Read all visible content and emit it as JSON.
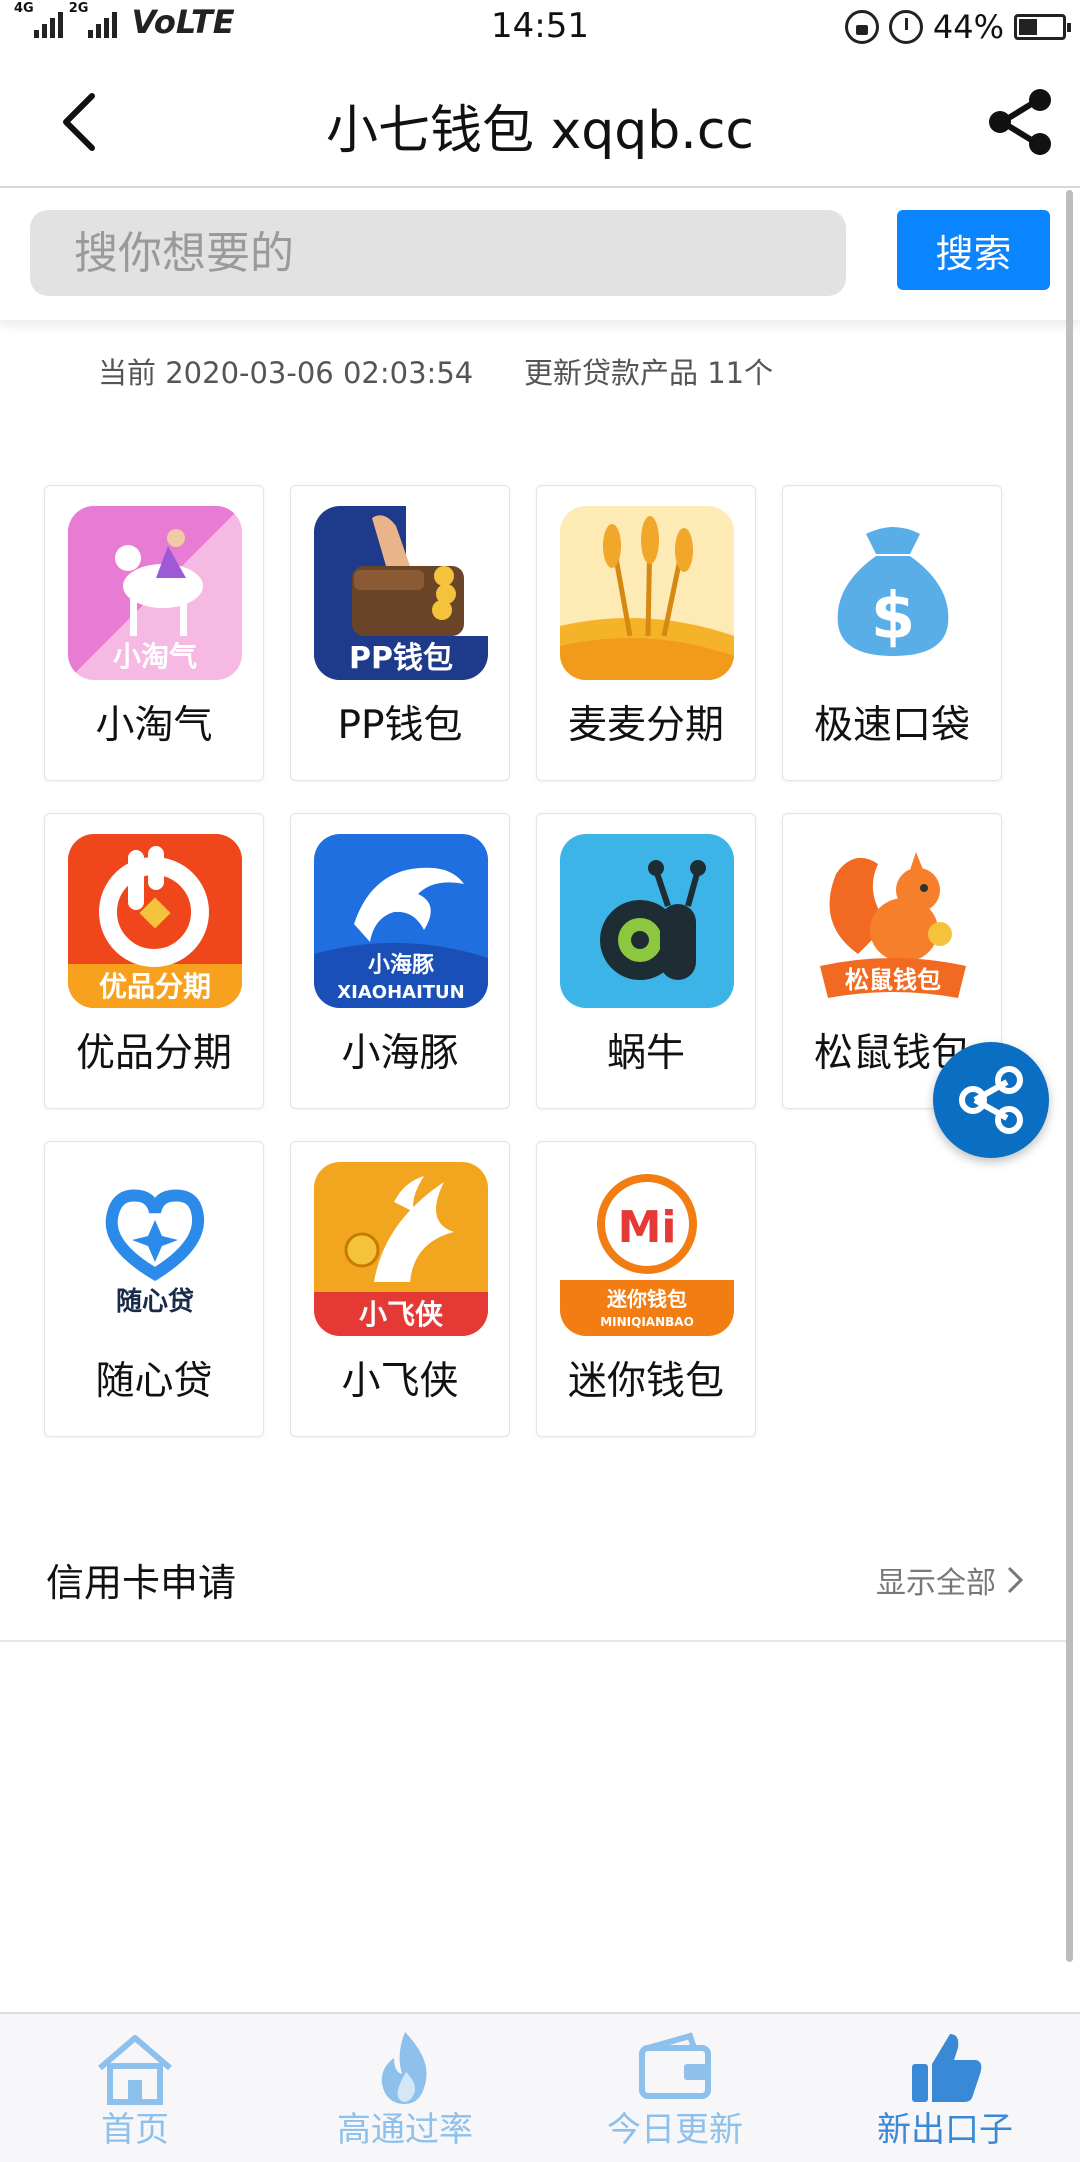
{
  "status_bar": {
    "network_left": "4G",
    "network_right": "2G",
    "carrier_label": "VoLTE",
    "time": "14:51",
    "battery_percent": "44%",
    "battery_level": 0.44,
    "icons": [
      "lock-rotation-icon",
      "alarm-icon",
      "battery-icon"
    ]
  },
  "header": {
    "title": "小七钱包 xqqb.cc",
    "back_icon": "chevron-left-icon",
    "share_icon": "share-icon"
  },
  "search": {
    "placeholder": "搜你想要的",
    "button_label": "搜索"
  },
  "info": {
    "current_label": "当前 2020-03-06 02:03:54",
    "update_label": "更新贷款产品 11个"
  },
  "products": [
    {
      "name": "小淘气",
      "logo_text": "小淘气",
      "color": "#f08ad0"
    },
    {
      "name": "PP钱包",
      "logo_text": "PP钱包",
      "color": "#1e3a8a"
    },
    {
      "name": "麦麦分期",
      "logo_text": "",
      "color": "#f5a623"
    },
    {
      "name": "极速口袋",
      "logo_text": "$",
      "color": "#5aaee8"
    },
    {
      "name": "优品分期",
      "logo_text": "优品分期",
      "color": "#f0461c"
    },
    {
      "name": "小海豚",
      "logo_text": "小海豚",
      "logo_subtext": "XIAOHAITUN",
      "color": "#1f6fe0"
    },
    {
      "name": "蜗牛",
      "logo_text": "",
      "color": "#3db4e8"
    },
    {
      "name": "松鼠钱包",
      "logo_text": "松鼠钱包",
      "color": "#f26a21"
    },
    {
      "name": "随心贷",
      "logo_text": "随心贷",
      "color": "#2c8ae8"
    },
    {
      "name": "小飞侠",
      "logo_text": "小飞侠",
      "color": "#f2a51e"
    },
    {
      "name": "迷你钱包",
      "logo_text": "迷你钱包",
      "logo_subtext": "MINIQIANBAO",
      "color": "#f27d12"
    }
  ],
  "credit_card": {
    "title": "信用卡申请",
    "show_all": "显示全部"
  },
  "bottom_nav": [
    {
      "label": "首页",
      "icon": "home-icon"
    },
    {
      "label": "高通过率",
      "icon": "flame-icon"
    },
    {
      "label": "今日更新",
      "icon": "wallet-icon"
    },
    {
      "label": "新出口子",
      "icon": "thumbs-up-icon",
      "active": true
    }
  ],
  "colors": {
    "accent": "#0a84ff",
    "fab": "#0a6fc2",
    "nav_inactive": "#8ec0ec",
    "nav_active": "#3a89d6"
  }
}
